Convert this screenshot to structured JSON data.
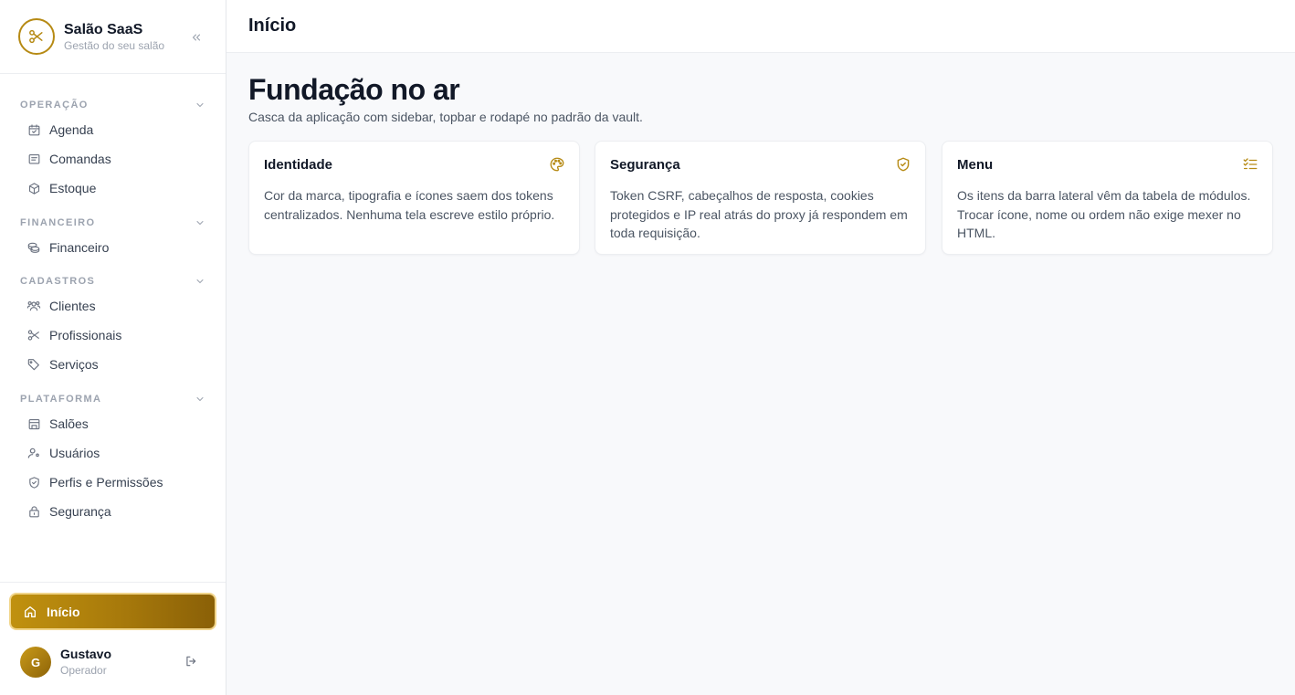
{
  "brand": {
    "name": "Salão SaaS",
    "subtitle": "Gestão do seu salão"
  },
  "colors": {
    "accent": "#b68a14",
    "accent_dark": "#8a6007",
    "text": "#111827",
    "muted": "#9ca3af"
  },
  "sidebar": {
    "sections": [
      {
        "title": "OPERAÇÃO",
        "items": [
          {
            "label": "Agenda",
            "icon": "calendar-icon"
          },
          {
            "label": "Comandas",
            "icon": "receipt-icon"
          },
          {
            "label": "Estoque",
            "icon": "box-icon"
          }
        ]
      },
      {
        "title": "FINANCEIRO",
        "items": [
          {
            "label": "Financeiro",
            "icon": "coins-icon"
          }
        ]
      },
      {
        "title": "CADASTROS",
        "items": [
          {
            "label": "Clientes",
            "icon": "users-icon"
          },
          {
            "label": "Profissionais",
            "icon": "scissors-icon"
          },
          {
            "label": "Serviços",
            "icon": "tag-icon"
          }
        ]
      },
      {
        "title": "PLATAFORMA",
        "items": [
          {
            "label": "Salões",
            "icon": "store-icon"
          },
          {
            "label": "Usuários",
            "icon": "user-icon"
          },
          {
            "label": "Perfis e Permissões",
            "icon": "shield-icon"
          },
          {
            "label": "Segurança",
            "icon": "lock-icon"
          }
        ]
      }
    ],
    "home_label": "Início",
    "user": {
      "initial": "G",
      "name": "Gustavo",
      "role": "Operador"
    }
  },
  "topbar": {
    "title": "Início"
  },
  "main": {
    "title": "Fundação no ar",
    "subtitle": "Casca da aplicação com sidebar, topbar e rodapé no padrão da vault.",
    "cards": [
      {
        "title": "Identidade",
        "icon": "palette-icon",
        "text": "Cor da marca, tipografia e ícones saem dos tokens centralizados. Nenhuma tela escreve estilo próprio."
      },
      {
        "title": "Segurança",
        "icon": "shield-check-icon",
        "text": "Token CSRF, cabeçalhos de resposta, cookies protegidos e IP real atrás do proxy já respondem em toda requisição."
      },
      {
        "title": "Menu",
        "icon": "list-check-icon",
        "text": "Os itens da barra lateral vêm da tabela de módulos. Trocar ícone, nome ou ordem não exige mexer no HTML."
      }
    ]
  }
}
